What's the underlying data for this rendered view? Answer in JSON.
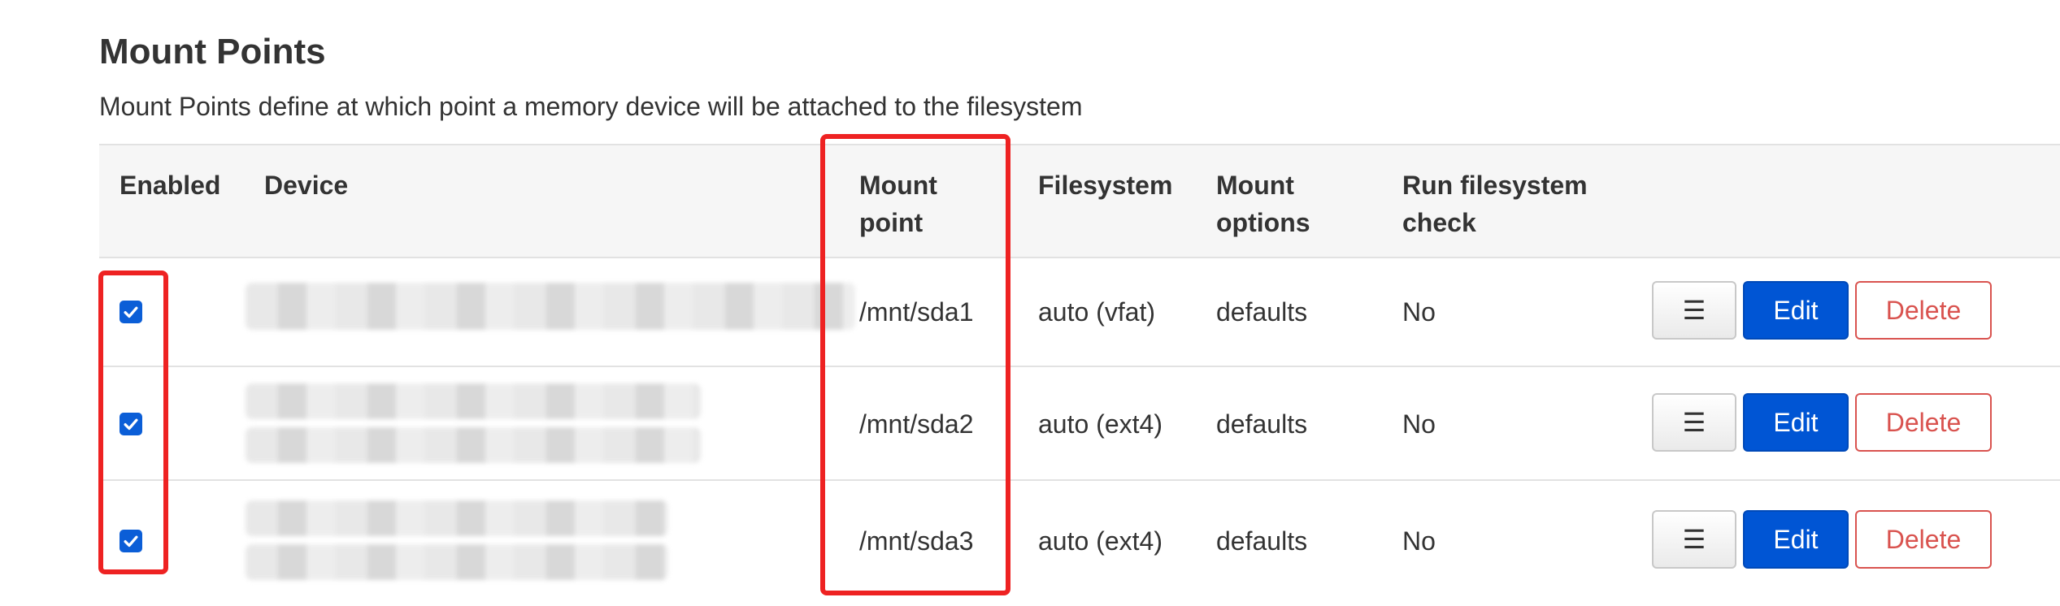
{
  "section": {
    "title": "Mount Points",
    "description": "Mount Points define at which point a memory device will be attached to the filesystem"
  },
  "table": {
    "headers": {
      "enabled": "Enabled",
      "device": "Device",
      "mount_point": "Mount point",
      "filesystem": "Filesystem",
      "mount_options": "Mount options",
      "run_fs_check": "Run filesystem check"
    },
    "rows": [
      {
        "enabled": true,
        "mount_point": "/mnt/sda1",
        "filesystem": "auto (vfat)",
        "mount_options": "defaults",
        "run_fs_check": "No"
      },
      {
        "enabled": true,
        "mount_point": "/mnt/sda2",
        "filesystem": "auto (ext4)",
        "mount_options": "defaults",
        "run_fs_check": "No"
      },
      {
        "enabled": true,
        "mount_point": "/mnt/sda3",
        "filesystem": "auto (ext4)",
        "mount_options": "defaults",
        "run_fs_check": "No"
      }
    ],
    "actions": {
      "menu_glyph": "☰",
      "edit_label": "Edit",
      "delete_label": "Delete"
    }
  },
  "colors": {
    "highlight": "#ee2222",
    "edit_button": "#0055d4",
    "delete_button": "#d9534f",
    "checkbox": "#0b5ed7"
  }
}
